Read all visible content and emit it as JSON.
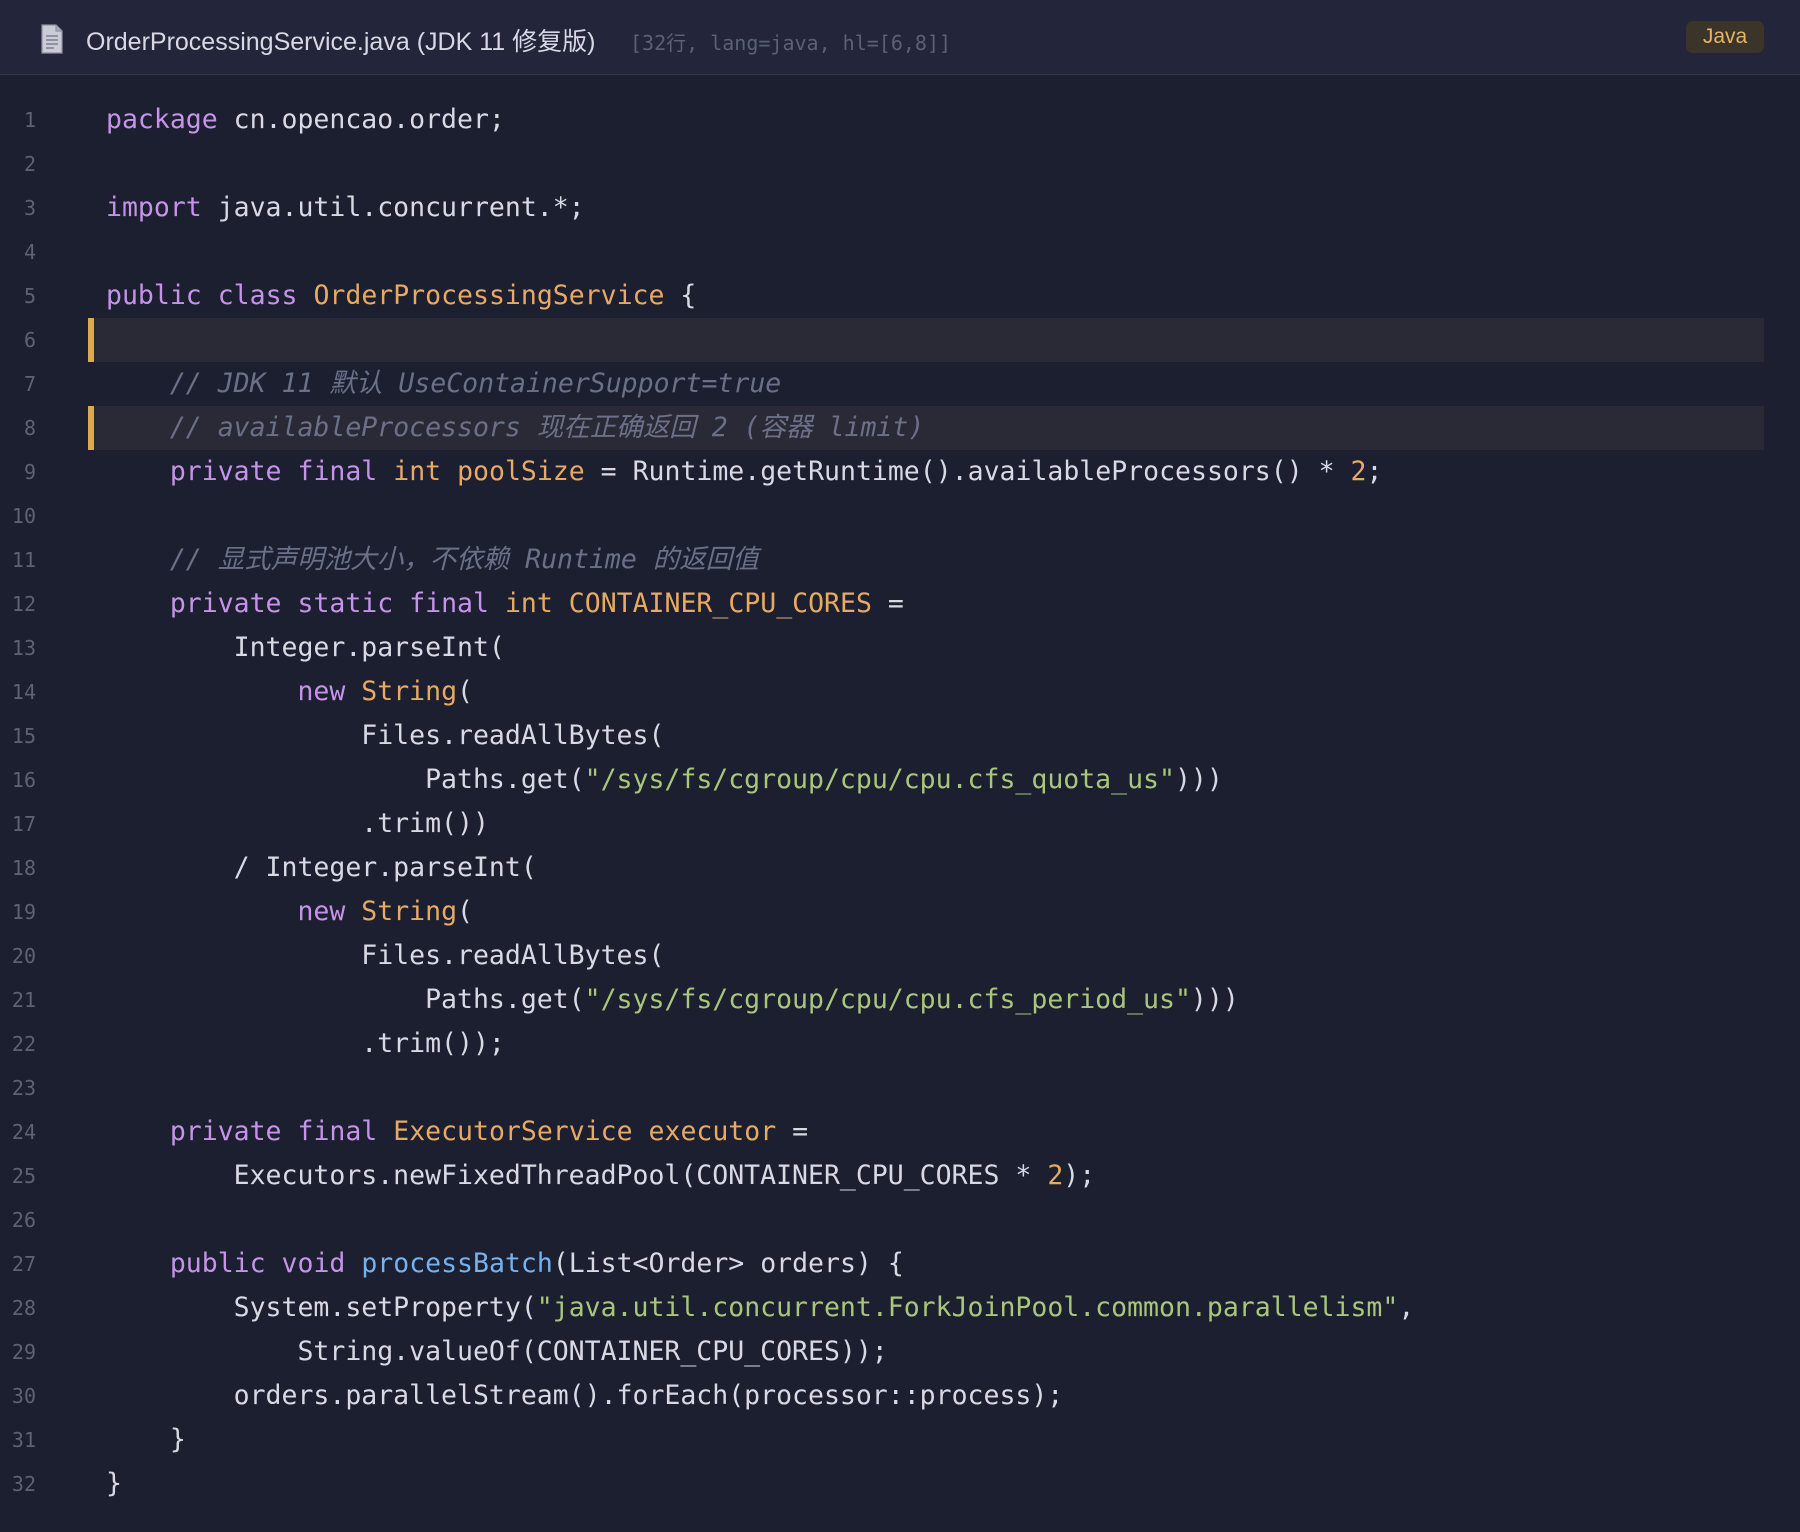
{
  "header": {
    "file_icon": "document-icon",
    "file_name": "OrderProcessingService.java (JDK 11 修复版)",
    "meta": "[32行, lang=java, hl=[6,8]]",
    "language_badge": "Java"
  },
  "colors": {
    "background": "#1c1f30",
    "keyword": "#c792ea",
    "type": "#e8a963",
    "string": "#a8c77a",
    "function": "#74b2f0",
    "comment": "#6b7089",
    "highlight_bar": "#e0a94d"
  },
  "code": {
    "highlighted_lines": [
      6,
      8
    ],
    "lines": [
      {
        "n": "1",
        "hl": false,
        "tokens": [
          {
            "t": "package",
            "c": "kw"
          },
          {
            "t": " cn.opencao.order;",
            "c": "pl"
          }
        ]
      },
      {
        "n": "2",
        "hl": false,
        "tokens": []
      },
      {
        "n": "3",
        "hl": false,
        "tokens": [
          {
            "t": "import",
            "c": "kw"
          },
          {
            "t": " java.util.concurrent.*;",
            "c": "pl"
          }
        ]
      },
      {
        "n": "4",
        "hl": false,
        "tokens": []
      },
      {
        "n": "5",
        "hl": false,
        "tokens": [
          {
            "t": "public",
            "c": "kw"
          },
          {
            "t": " ",
            "c": "pl"
          },
          {
            "t": "class",
            "c": "kw"
          },
          {
            "t": " ",
            "c": "pl"
          },
          {
            "t": "OrderProcessingService",
            "c": "type"
          },
          {
            "t": " {",
            "c": "pl"
          }
        ]
      },
      {
        "n": "6",
        "hl": true,
        "tokens": []
      },
      {
        "n": "7",
        "hl": false,
        "tokens": [
          {
            "t": "    ",
            "c": "pl"
          },
          {
            "t": "// JDK 11 默认 UseContainerSupport=true",
            "c": "cm"
          }
        ]
      },
      {
        "n": "8",
        "hl": true,
        "tokens": [
          {
            "t": "    ",
            "c": "pl"
          },
          {
            "t": "// availableProcessors 现在正确返回 2 (容器 limit)",
            "c": "cm"
          }
        ]
      },
      {
        "n": "9",
        "hl": false,
        "tokens": [
          {
            "t": "    ",
            "c": "pl"
          },
          {
            "t": "private",
            "c": "kw"
          },
          {
            "t": " ",
            "c": "pl"
          },
          {
            "t": "final",
            "c": "kw"
          },
          {
            "t": " ",
            "c": "pl"
          },
          {
            "t": "int",
            "c": "type"
          },
          {
            "t": " ",
            "c": "pl"
          },
          {
            "t": "poolSize",
            "c": "type"
          },
          {
            "t": " = Runtime.getRuntime().availableProcessors() * ",
            "c": "pl"
          },
          {
            "t": "2",
            "c": "num"
          },
          {
            "t": ";",
            "c": "pl"
          }
        ]
      },
      {
        "n": "10",
        "hl": false,
        "tokens": []
      },
      {
        "n": "11",
        "hl": false,
        "tokens": [
          {
            "t": "    ",
            "c": "pl"
          },
          {
            "t": "// 显式声明池大小，不依赖 Runtime 的返回值",
            "c": "cm"
          }
        ]
      },
      {
        "n": "12",
        "hl": false,
        "tokens": [
          {
            "t": "    ",
            "c": "pl"
          },
          {
            "t": "private",
            "c": "kw"
          },
          {
            "t": " ",
            "c": "pl"
          },
          {
            "t": "static",
            "c": "kw"
          },
          {
            "t": " ",
            "c": "pl"
          },
          {
            "t": "final",
            "c": "kw"
          },
          {
            "t": " ",
            "c": "pl"
          },
          {
            "t": "int",
            "c": "type"
          },
          {
            "t": " ",
            "c": "pl"
          },
          {
            "t": "CONTAINER_CPU_CORES",
            "c": "type"
          },
          {
            "t": " =",
            "c": "pl"
          }
        ]
      },
      {
        "n": "13",
        "hl": false,
        "tokens": [
          {
            "t": "        Integer.parseInt(",
            "c": "pl"
          }
        ]
      },
      {
        "n": "14",
        "hl": false,
        "tokens": [
          {
            "t": "            ",
            "c": "pl"
          },
          {
            "t": "new",
            "c": "kw"
          },
          {
            "t": " ",
            "c": "pl"
          },
          {
            "t": "String",
            "c": "type"
          },
          {
            "t": "(",
            "c": "pl"
          }
        ]
      },
      {
        "n": "15",
        "hl": false,
        "tokens": [
          {
            "t": "                Files.readAllBytes(",
            "c": "pl"
          }
        ]
      },
      {
        "n": "16",
        "hl": false,
        "tokens": [
          {
            "t": "                    Paths.get(",
            "c": "pl"
          },
          {
            "t": "\"/sys/fs/cgroup/cpu/cpu.cfs_quota_us\"",
            "c": "str"
          },
          {
            "t": ")))",
            "c": "pl"
          }
        ]
      },
      {
        "n": "17",
        "hl": false,
        "tokens": [
          {
            "t": "                .trim())",
            "c": "pl"
          }
        ]
      },
      {
        "n": "18",
        "hl": false,
        "tokens": [
          {
            "t": "        / Integer.parseInt(",
            "c": "pl"
          }
        ]
      },
      {
        "n": "19",
        "hl": false,
        "tokens": [
          {
            "t": "            ",
            "c": "pl"
          },
          {
            "t": "new",
            "c": "kw"
          },
          {
            "t": " ",
            "c": "pl"
          },
          {
            "t": "String",
            "c": "type"
          },
          {
            "t": "(",
            "c": "pl"
          }
        ]
      },
      {
        "n": "20",
        "hl": false,
        "tokens": [
          {
            "t": "                Files.readAllBytes(",
            "c": "pl"
          }
        ]
      },
      {
        "n": "21",
        "hl": false,
        "tokens": [
          {
            "t": "                    Paths.get(",
            "c": "pl"
          },
          {
            "t": "\"/sys/fs/cgroup/cpu/cpu.cfs_period_us\"",
            "c": "str"
          },
          {
            "t": ")))",
            "c": "pl"
          }
        ]
      },
      {
        "n": "22",
        "hl": false,
        "tokens": [
          {
            "t": "                .trim());",
            "c": "pl"
          }
        ]
      },
      {
        "n": "23",
        "hl": false,
        "tokens": []
      },
      {
        "n": "24",
        "hl": false,
        "tokens": [
          {
            "t": "    ",
            "c": "pl"
          },
          {
            "t": "private",
            "c": "kw"
          },
          {
            "t": " ",
            "c": "pl"
          },
          {
            "t": "final",
            "c": "kw"
          },
          {
            "t": " ",
            "c": "pl"
          },
          {
            "t": "ExecutorService",
            "c": "type"
          },
          {
            "t": " ",
            "c": "pl"
          },
          {
            "t": "executor",
            "c": "type"
          },
          {
            "t": " =",
            "c": "pl"
          }
        ]
      },
      {
        "n": "25",
        "hl": false,
        "tokens": [
          {
            "t": "        Executors.newFixedThreadPool(CONTAINER_CPU_CORES * ",
            "c": "pl"
          },
          {
            "t": "2",
            "c": "num"
          },
          {
            "t": ");",
            "c": "pl"
          }
        ]
      },
      {
        "n": "26",
        "hl": false,
        "tokens": []
      },
      {
        "n": "27",
        "hl": false,
        "tokens": [
          {
            "t": "    ",
            "c": "pl"
          },
          {
            "t": "public",
            "c": "kw"
          },
          {
            "t": " ",
            "c": "pl"
          },
          {
            "t": "void",
            "c": "kw"
          },
          {
            "t": " ",
            "c": "pl"
          },
          {
            "t": "processBatch",
            "c": "fn"
          },
          {
            "t": "(List<Order> orders) {",
            "c": "pl"
          }
        ]
      },
      {
        "n": "28",
        "hl": false,
        "tokens": [
          {
            "t": "        System.setProperty(",
            "c": "pl"
          },
          {
            "t": "\"java.util.concurrent.ForkJoinPool.common.parallelism\"",
            "c": "str"
          },
          {
            "t": ",",
            "c": "pl"
          }
        ]
      },
      {
        "n": "29",
        "hl": false,
        "tokens": [
          {
            "t": "            String.valueOf(CONTAINER_CPU_CORES));",
            "c": "pl"
          }
        ]
      },
      {
        "n": "30",
        "hl": false,
        "tokens": [
          {
            "t": "        orders.parallelStream().forEach(processor::process);",
            "c": "pl"
          }
        ]
      },
      {
        "n": "31",
        "hl": false,
        "tokens": [
          {
            "t": "    }",
            "c": "pl"
          }
        ]
      },
      {
        "n": "32",
        "hl": false,
        "tokens": [
          {
            "t": "}",
            "c": "pl"
          }
        ]
      }
    ]
  }
}
